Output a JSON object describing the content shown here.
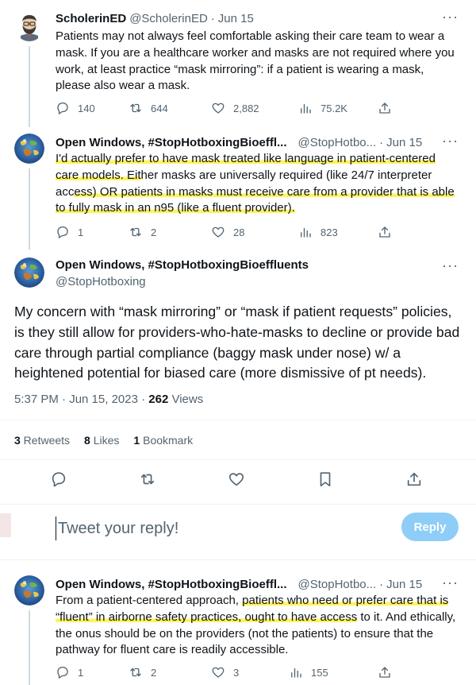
{
  "tweets": [
    {
      "name": "ScholerinED",
      "handle": "@ScholerinED",
      "date": "Jun 15",
      "text": "Patients may not always feel comfortable asking their care team to wear a mask. If you are a healthcare worker and masks are not required where you work, at least practice “mask mirroring”: if a patient is wearing a mask, please also wear a mask.",
      "replies": "140",
      "retweets": "644",
      "likes": "2,882",
      "views": "75.2K"
    },
    {
      "name": "Open Windows, #StopHotboxingBioeffl...",
      "handle": "@StopHotbo...",
      "date": "Jun 15",
      "text_a": "I'd actually prefer to have mask treated like language in patient-centered care models. Eit",
      "text_b": "her masks are universally required (like 24/7 interpreter acc",
      "text_c": "ess) OR patients in masks must receive care from a provider that is able to fully mask in an n95 (like a fluent provider).",
      "replies": "1",
      "retweets": "2",
      "likes": "28",
      "views": "823"
    }
  ],
  "main": {
    "name": "Open Windows, #StopHotboxingBioeffluents",
    "handle": "@StopHotboxing",
    "text": "My concern with “mask mirroring” or “mask if patient requests” policies, is they still allow for providers-who-hate-masks to decline or provide bad care through partial compliance (baggy mask under nose) w/ a heightened potential for biased care (more dismissive of pt needs).",
    "time": "5:37 PM · Jun 15, 2023 · ",
    "views_count": "262",
    "views_label": " Views",
    "retweets_count": "3",
    "retweets_label": " Retweets",
    "likes_count": "8",
    "likes_label": " Likes",
    "bookmarks_count": "1",
    "bookmarks_label": " Bookmark"
  },
  "reply_box": {
    "placeholder": "Tweet your reply!",
    "button": "Reply"
  },
  "reply": {
    "name": "Open Windows, #StopHotboxingBioeffl...",
    "handle": "@StopHotbo...",
    "date": "Jun 15",
    "text_a": "From a patient-centered approach, ",
    "text_b": "patients who need or prefer care that is “fluent” in airborne safety practices, ought to have access",
    "text_c": " to it. And ethically, the onus should be on the providers (not the patients) to ensure that the pathway for fluent care is readily accessible.",
    "replies": "1",
    "retweets": "2",
    "likes": "3",
    "views": "155"
  },
  "dot": "·",
  "more": "···",
  "colors": {
    "highlight": "#fff35a",
    "reply_button": "#8ecdf8",
    "muted": "#536471",
    "divider": "#eff3f4"
  }
}
